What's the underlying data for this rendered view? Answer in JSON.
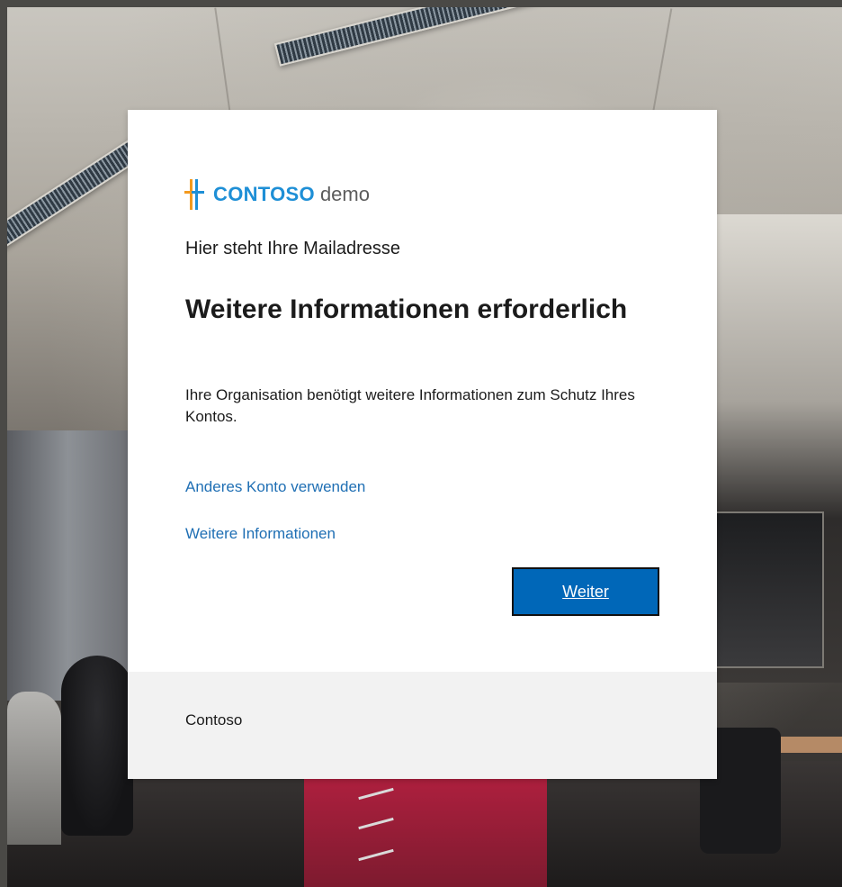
{
  "background": {
    "description_icon": "office-background-photo"
  },
  "brand": {
    "name": "CONTOSO",
    "suffix": "demo",
    "primary_color": "#1e8fd6",
    "secondary_color": "#f39a1e",
    "logo_icon": "contoso-cross-logo-icon"
  },
  "signin": {
    "email": "Hier steht Ihre Mailadresse",
    "title": "Weitere Informationen erforderlich",
    "description": "Ihre Organisation benötigt weitere Informationen zum Schutz Ihres Kontos.",
    "link_other_account": "Anderes Konto verwenden",
    "link_more_info": "Weitere Informationen",
    "next_button": "Weiter",
    "button_color": "#0067b8",
    "link_color": "#1f6fb4"
  },
  "footer": {
    "text": "Contoso"
  }
}
